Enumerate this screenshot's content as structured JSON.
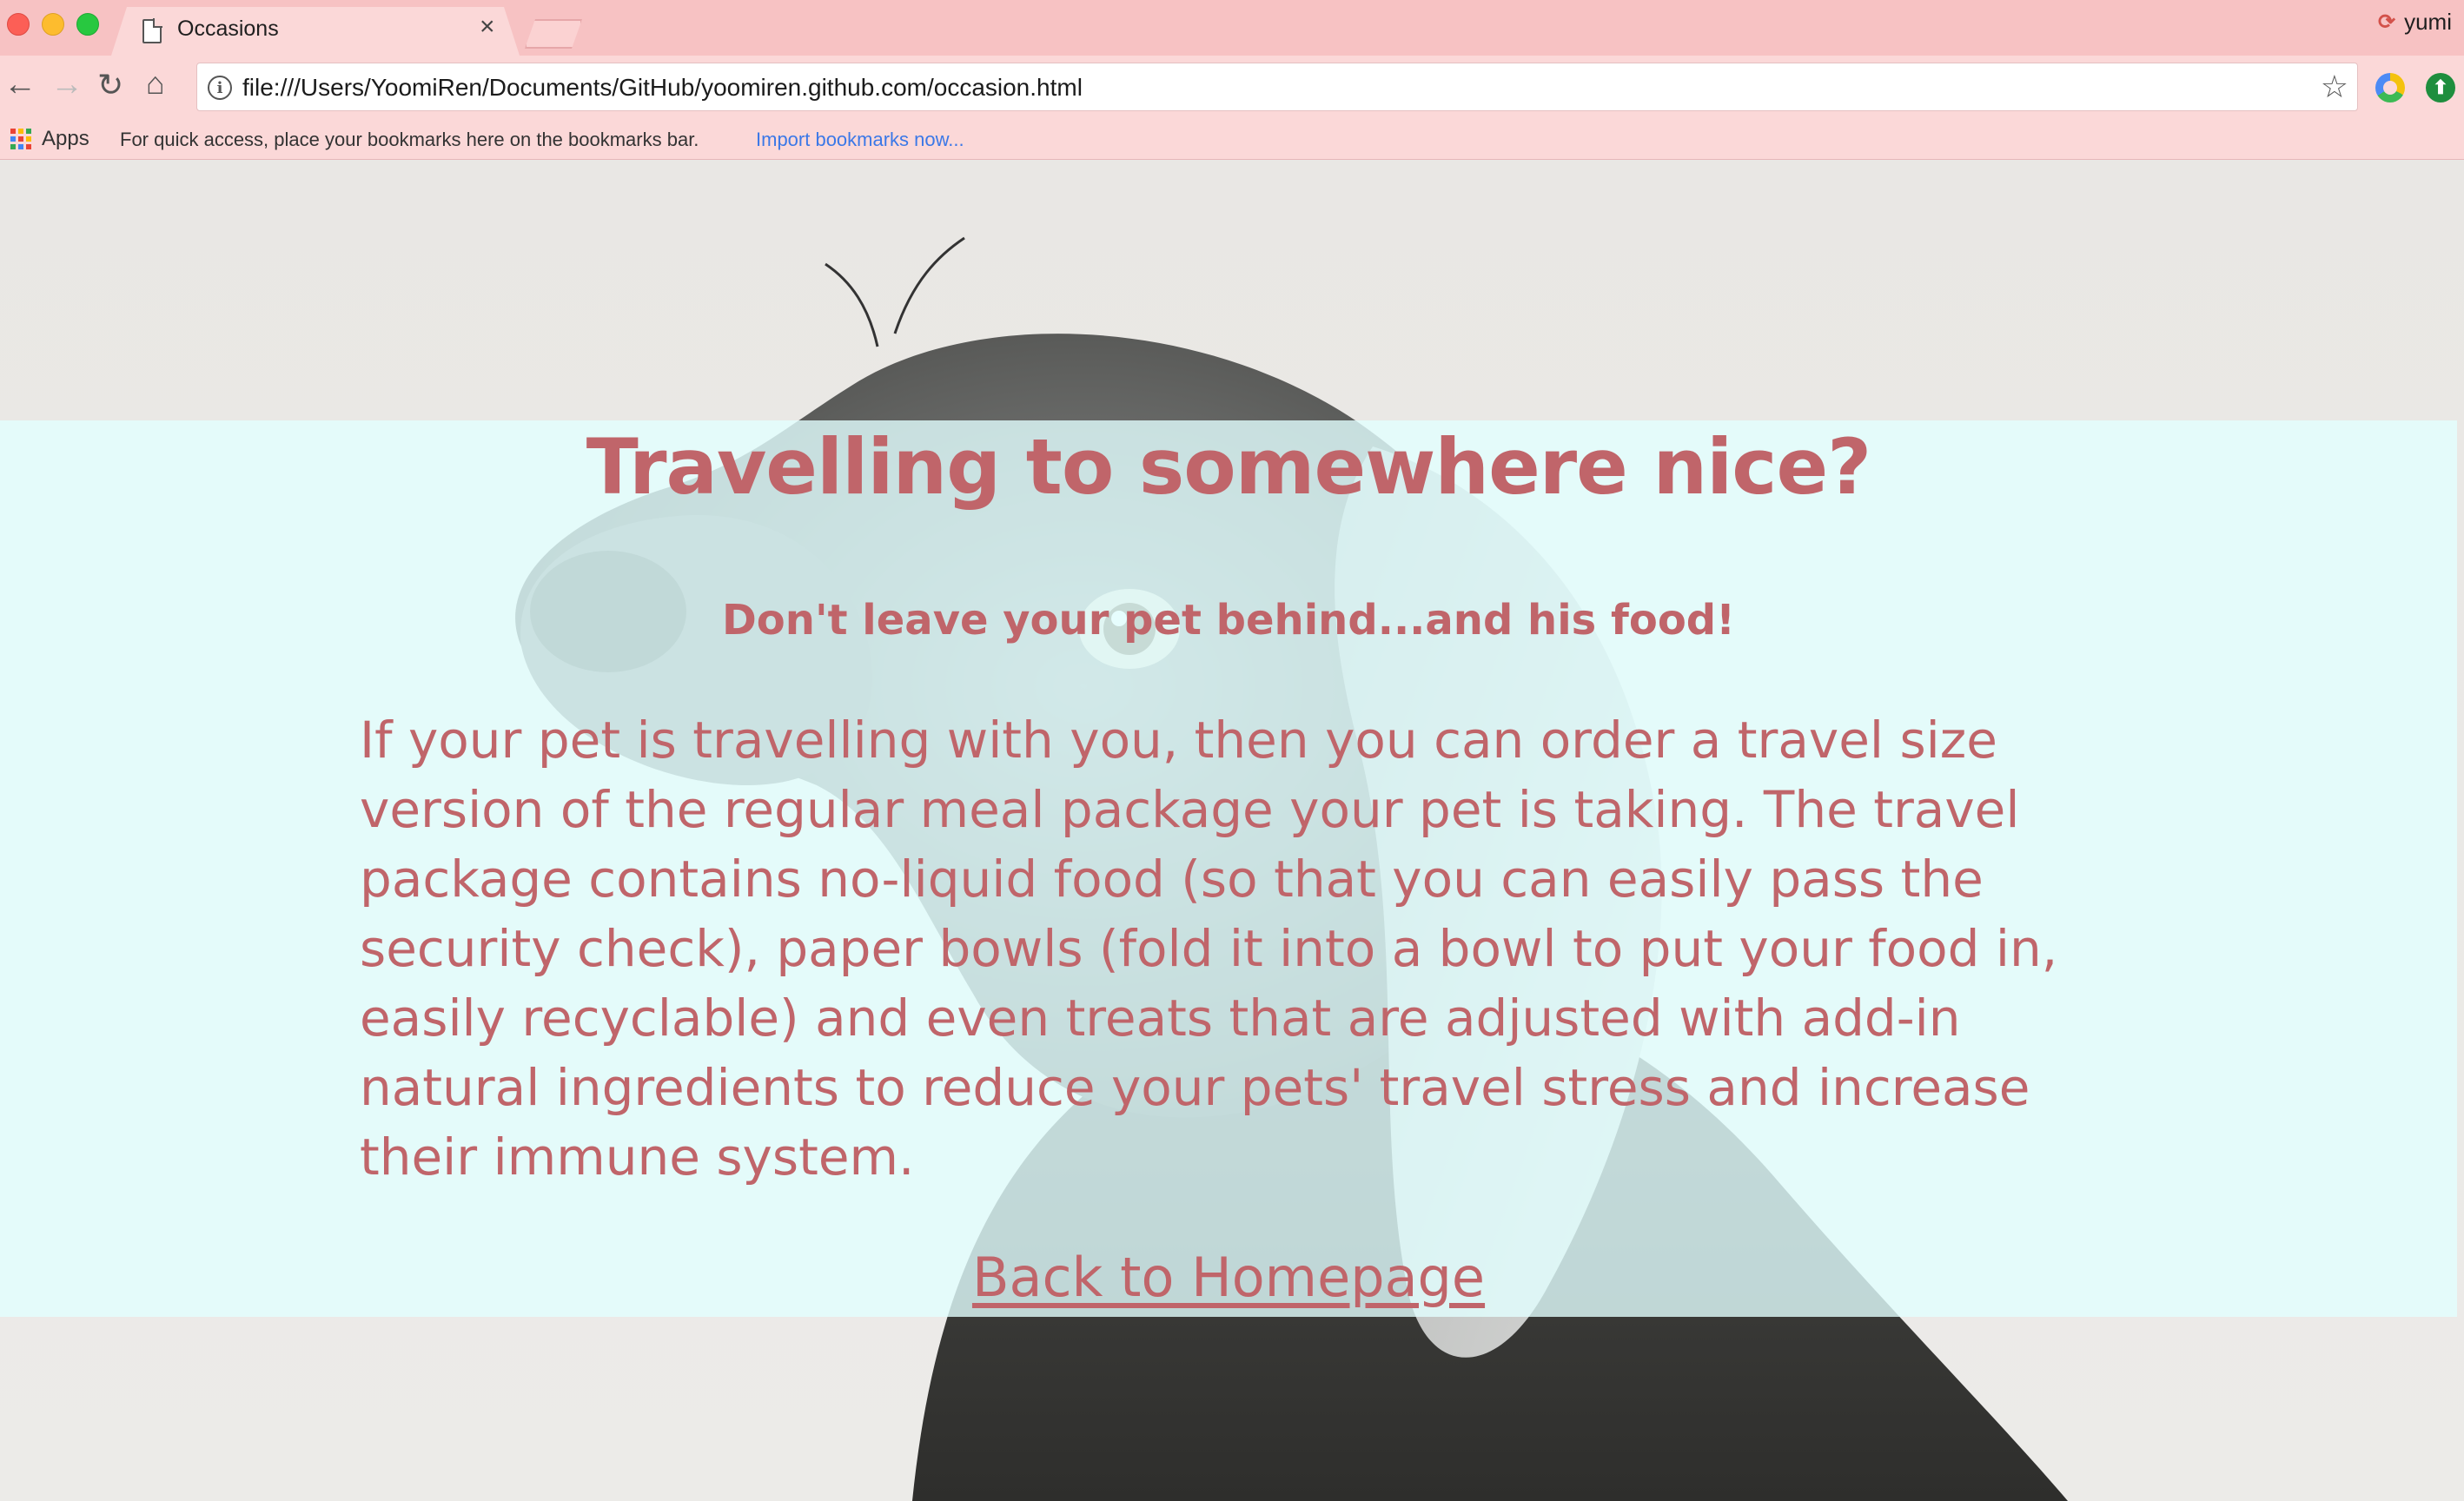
{
  "browser": {
    "tab_title": "Occasions",
    "tab_close": "×",
    "profile_name": "yumi",
    "url": "file:///Users/YoomiRen/Documents/GitHub/yoomiren.github.com/occasion.html",
    "nav": {
      "back": "←",
      "forward": "→",
      "reload": "↻",
      "home": "⌂",
      "info": "i",
      "star": "☆"
    },
    "extension_2_glyph": "⬆"
  },
  "bookmarks_bar": {
    "apps_label": "Apps",
    "hint": "For quick access, place your bookmarks here on the bookmarks bar.",
    "import_link": "Import bookmarks now..."
  },
  "page": {
    "heading": "Travelling to somewhere nice?",
    "subheading": "Don't leave your pet behind...and his food!",
    "body": "If your pet is travelling with you, then you can order a travel size version of the regular meal package your pet is taking. The travel package contains no-liquid food (so that you can easily pass the security check), paper bowls (fold it into a bowl to put your food in, easily recyclable) and even treats that are adjusted with add-in natural ingredients to reduce your pets' travel stress and increase their immune system.",
    "home_link": "Back to Homepage",
    "background_image": "dog-looking-up",
    "text_color": "#c0656a",
    "overlay_color": "#e2ffff"
  },
  "colors": {
    "titlebar": "#f7c2c3",
    "toolbar": "#fbd8d8",
    "link_blue": "#3b78e7"
  }
}
